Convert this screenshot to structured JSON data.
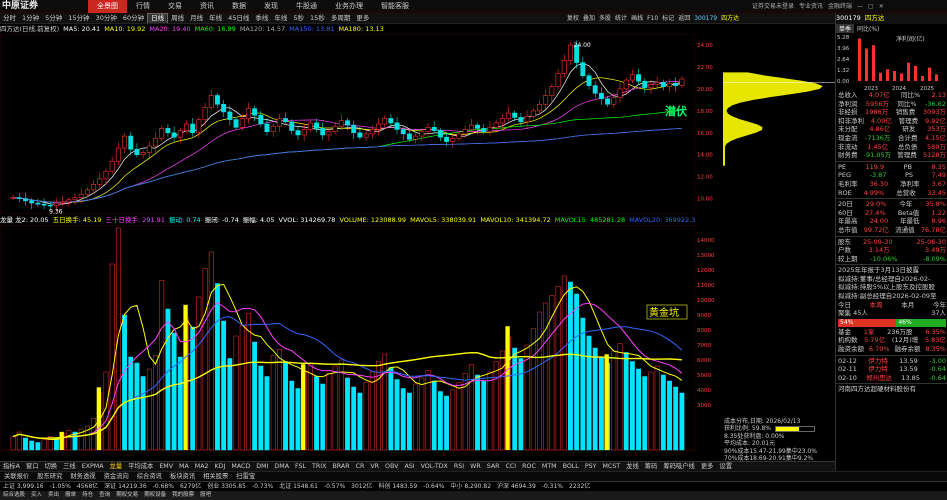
{
  "app": {
    "logo_text": "中原证券",
    "menu": [
      "全景图",
      "行情",
      "交易",
      "资讯",
      "数据",
      "发现",
      "牛股通",
      "业务办理",
      "智能客服"
    ],
    "active_menu": 0,
    "login_status": "证券交易未登录",
    "header_right": [
      "专业资讯",
      "金融终端"
    ]
  },
  "periodbar": {
    "periods": [
      "分时",
      "1分钟",
      "5分钟",
      "15分钟",
      "30分钟",
      "60分钟",
      "日线",
      "周线",
      "月线",
      "年线",
      "45日线",
      "季线",
      "年线",
      "5秒",
      "15秒",
      "多周期",
      "更多"
    ],
    "selected": 6,
    "tools": [
      "复权",
      "叠加",
      "多股",
      "统计",
      "画线",
      "F10",
      "标记",
      "返回"
    ]
  },
  "stock": {
    "code": "300179",
    "name": "四方达",
    "adjust": "四方达(日线,前复权)"
  },
  "ma": [
    {
      "label": "MA5: 20.41",
      "color": "#ffffff"
    },
    {
      "label": "MA10: 19.92",
      "color": "#ffff00"
    },
    {
      "label": "MA20: 19.40",
      "color": "#ff40ff"
    },
    {
      "label": "MA60: 16.99",
      "color": "#00ff00"
    },
    {
      "label": "MA120: 14.57",
      "color": "#aaaaaa"
    },
    {
      "label": "MA150: 13.81",
      "color": "#3366ff"
    },
    {
      "label": "MA180: 13.13",
      "color": "#ffff00"
    }
  ],
  "price_chart": {
    "high_label": "24.00",
    "low_label": "9.36",
    "scale": [
      "24.00",
      "22.00",
      "20.00",
      "18.00",
      "16.00",
      "14.00",
      "12.00",
      "10.00"
    ],
    "scale_values": [
      24,
      22,
      20,
      18,
      16,
      14,
      12,
      10
    ],
    "ymin": 8.6,
    "ymax": 25,
    "signal_label": "潜伏",
    "closes": [
      10.1,
      10.0,
      9.8,
      9.6,
      9.5,
      9.4,
      9.36,
      9.6,
      9.7,
      9.9,
      10.1,
      10.4,
      10.8,
      11.3,
      11.8,
      12.5,
      13.4,
      14.6,
      15.7,
      14.5,
      14.0,
      14.2,
      14.8,
      15.5,
      16.4,
      16.0,
      15.6,
      16.2,
      16.8,
      16.0,
      17.2,
      18.3,
      19.4,
      18.6,
      17.9,
      17.2,
      16.5,
      17.3,
      18.2,
      17.6,
      16.8,
      16.1,
      16.6,
      17.3,
      17.0,
      16.2,
      15.8,
      16.3,
      16.9,
      16.4,
      15.8,
      16.1,
      16.6,
      17.1,
      16.7,
      16.0,
      15.6,
      15.9,
      16.3,
      16.8,
      17.3,
      16.9,
      16.3,
      15.9,
      15.4,
      15.7,
      16.1,
      16.5,
      16.2,
      15.6,
      15.2,
      15.5,
      15.9,
      16.3,
      16.7,
      16.4,
      16.1,
      16.5,
      16.9,
      17.3,
      17.8,
      17.4,
      17.0,
      17.5,
      18.0,
      18.6,
      19.4,
      20.2,
      21.4,
      22.6,
      24.0,
      22.4,
      21.2,
      20.3,
      19.6,
      19.1,
      18.6,
      19.2,
      20.0,
      20.8,
      21.3,
      20.7,
      20.1,
      20.4,
      20.6,
      20.2,
      20.5,
      20.3,
      20.9
    ]
  },
  "indicator": {
    "labels": [
      {
        "text": "龙量 龙2: 20.05",
        "color": "#ffffff"
      },
      {
        "text": "五日换手: 45.19",
        "color": "#ffff00"
      },
      {
        "text": "三十日换手: 291.91",
        "color": "#ff40ff"
      },
      {
        "text": "振动: 0.74",
        "color": "#00ffff"
      },
      {
        "text": "振闭: -0.74",
        "color": "#ffffff"
      },
      {
        "text": "振幅: 4.05",
        "color": "#ffffff"
      },
      {
        "text": "VVOL: 314269.78",
        "color": "#ffffff"
      },
      {
        "text": "VOLUME: 123088.99",
        "color": "#ffff00"
      },
      {
        "text": "MAVOL5: 338039.91",
        "color": "#ffff00"
      },
      {
        "text": "MAVOL10: 341394.72",
        "color": "#ffff00"
      },
      {
        "text": "MAVOL15: 485281.28",
        "color": "#00ff00"
      },
      {
        "text": "MAVOL20: 369922.34",
        "color": "#3366ff"
      },
      {
        "text": "MAVOL60",
        "color": "#ffff00"
      }
    ],
    "scale": [
      "14000",
      "13000",
      "12000",
      "11000",
      "10000",
      "9000",
      "8000",
      "7000",
      "6000",
      "5000",
      "4000",
      "3000",
      "2000",
      "1000"
    ],
    "scale_values": [
      14000,
      13000,
      12000,
      11000,
      10000,
      9000,
      8000,
      7000,
      6000,
      5000,
      4000,
      3000,
      2000,
      1000
    ],
    "ymax": 15000,
    "signal_label": "黄金坑",
    "volumes": [
      900,
      1200,
      800,
      600,
      500,
      700,
      900,
      800,
      1100,
      1300,
      1200,
      1400,
      1600,
      2100,
      3800,
      5200,
      12400,
      14800,
      9000,
      6200,
      5800,
      4900,
      5400,
      6300,
      11300,
      9400,
      7800,
      6200,
      8800,
      8200,
      10200,
      12100,
      13200,
      11100,
      8600,
      6100,
      7600,
      8300,
      9100,
      7200,
      5600,
      4900,
      6300,
      6700,
      5900,
      4600,
      4100,
      5200,
      5800,
      4900,
      4400,
      5100,
      5600,
      6000,
      4800,
      4200,
      3800,
      4500,
      5200,
      5900,
      6400,
      5500,
      4700,
      4100,
      3800,
      4400,
      4800,
      5300,
      4600,
      3900,
      3600,
      4000,
      4500,
      5100,
      5700,
      5000,
      4600,
      5200,
      5900,
      6600,
      7500,
      6800,
      6100,
      7000,
      8100,
      9200,
      9800,
      10300,
      10900,
      11600,
      11200,
      10400,
      8800,
      7600,
      6800,
      6200,
      5800,
      6600,
      7100,
      6500,
      5900,
      5400,
      4900,
      5200,
      5600,
      5000,
      4600,
      4200,
      3800
    ]
  },
  "chip": {
    "lines": [
      "成本分布,日期: 2026/02/13",
      "获利比例: 59.8%",
      "8.35处获利盘: 0.00%",
      "平均成本: 20.01元",
      "90%成本15.47-21.99集中23.0%",
      "70%成本18.69-20.91集中9.2%"
    ],
    "profit_pct": 59.8
  },
  "rightpanel": {
    "code": "300179",
    "name": "四方达",
    "tabs": [
      "单季",
      "同比(%)"
    ],
    "bar_title": "净利润(亿)",
    "bar_scale": [
      "5.28",
      "3.96",
      "2.64",
      "1.32",
      "0.00"
    ],
    "bars": [
      {
        "v": 5.1
      },
      {
        "v": 3.9
      },
      {
        "v": 4.3
      },
      {
        "v": 1.0
      },
      {
        "v": 1.4
      },
      {
        "v": 1.2
      },
      {
        "v": 0.9
      },
      {
        "v": 2.2
      },
      {
        "v": 1.8
      },
      {
        "v": 0.6
      },
      {
        "v": 1.6
      },
      {
        "v": 0.8
      }
    ],
    "years": [
      "2023",
      "2024",
      "2025"
    ],
    "fin": [
      [
        "总收入",
        "4.07亿",
        "同比%",
        "2.13"
      ],
      [
        "净利润",
        "5956万",
        "同比%",
        "-36.62"
      ],
      [
        "非经损",
        "1986万",
        "销售费",
        "3093万"
      ],
      [
        "扣非净利",
        "4.09亿",
        "管理费",
        "9.92亿"
      ],
      [
        "未分配",
        "4.86亿",
        "研发",
        "353万"
      ],
      [
        "现金流",
        "-7136万",
        "合计费",
        "4.15亿"
      ],
      [
        "非流动",
        "1.45亿",
        "总负债",
        "580万"
      ],
      [
        "财务费",
        "-91.05万",
        "管理费",
        "5128万"
      ]
    ],
    "valuation": [
      [
        "PE",
        "119.9",
        "PB",
        "8.35"
      ],
      [
        "PEG",
        "-3.87",
        "PS",
        "7.49"
      ],
      [
        "毛利率",
        "36.30",
        "净利率",
        "3.67"
      ],
      [
        "ROE",
        "4.99%",
        "总营收",
        "33.45"
      ]
    ],
    "returns": [
      [
        "20日",
        "29.0%",
        "今年",
        "35.8%"
      ],
      [
        "60日",
        "27.4%",
        "Beta值",
        "1.22"
      ],
      [
        "年最高",
        "24.00",
        "年最低",
        "8.96"
      ],
      [
        "总市值",
        "99.72亿",
        "流通值",
        "76.78亿"
      ]
    ],
    "holders": [
      [
        "股东",
        "25-09-30",
        "",
        "25-06-30"
      ],
      [
        "户数",
        "3.14万",
        "",
        "3.49万"
      ],
      [
        "较上期",
        "-10.06%",
        "",
        "-8.09%"
      ]
    ],
    "report_note": "2025年年报于3月13日披露",
    "news": [
      "拟减持:董事/总经理自2026-02-",
      "拟减持:持股5%以上股东及控股股",
      "拟减持:副总经理自2026-02-09至"
    ],
    "flow_tabs": [
      "今日",
      "本周",
      "本月",
      "今年"
    ],
    "sentiment": {
      "label": "聚集 45人",
      "count": "37人",
      "left": "54%",
      "right": "46%",
      "left_num": 54
    },
    "funds": [
      [
        "基金",
        "1家",
        "236万股",
        "6.35%"
      ],
      [
        "机构数",
        "5.79亿",
        "(12月)增",
        "5.83亿"
      ],
      [
        "融资余额",
        "6.70%",
        "融券余额",
        "8.35%"
      ]
    ],
    "lhb": [
      [
        "02-12",
        "伊力特",
        "13.59",
        "-3.00"
      ],
      [
        "02-11",
        "伊力特",
        "13.59",
        "-0.64"
      ],
      [
        "02-10",
        "郑州思达",
        "13.85",
        "-0.64"
      ]
    ],
    "cal_note": "河南四方达超硬材料股份有"
  },
  "tabbar": {
    "items": [
      "指标A",
      "窗口",
      "切换",
      "三线",
      "EXPMA",
      "龙量",
      "平均成本",
      "EMV",
      "MA",
      "MA2",
      "KDJ",
      "MACD",
      "DMI",
      "DMA",
      "FSL",
      "TRIX",
      "BRAR",
      "CR",
      "VR",
      "OBV",
      "ASI",
      "VOL-TDX",
      "RSI",
      "WR",
      "SAR",
      "CCI",
      "ROC",
      "MTM",
      "BOLL",
      "PSY",
      "MCST",
      "龙线",
      "筹码",
      "筹码吸户线",
      "更多",
      "设置"
    ],
    "selected": 5,
    "right": [
      "指标栏",
      "模",
      "板"
    ]
  },
  "funcbar": {
    "items": [
      "关联报价",
      "股东研究",
      "财务透视",
      "资金流向",
      "综合资讯",
      "板块资讯",
      "相关股票",
      "扫雷宝"
    ]
  },
  "statusbar": {
    "items": [
      "上证 3,999.16",
      "-1.05%",
      "4568亿",
      "深证 14219.36",
      "-0.68%",
      "6279亿",
      "创业 3305.85",
      "-0.73%",
      "北证 1548.61",
      "-0.57%",
      "3012亿",
      "科创 1483.59",
      "-0.64%",
      "中小 8,290.82",
      "沪深 4694.39",
      "-0.31%",
      "2232亿"
    ]
  },
  "taskbar": {
    "items": [
      "综合选股",
      "买入",
      "卖出",
      "撤单",
      "持仓",
      "查询",
      "期权交易",
      "期权设备",
      "我的股票",
      "股吧"
    ]
  }
}
